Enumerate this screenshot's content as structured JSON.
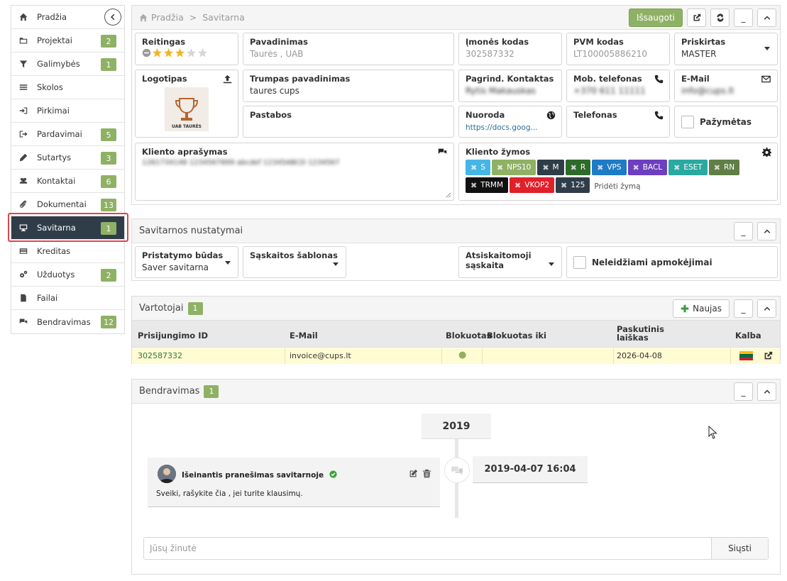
{
  "sidebar": {
    "items": [
      {
        "label": "Pradžia",
        "icon": "home-icon",
        "badge": ""
      },
      {
        "label": "Projektai",
        "icon": "folder-icon",
        "badge": "2"
      },
      {
        "label": "Galimybės",
        "icon": "filter-icon",
        "badge": "1"
      },
      {
        "label": "Skolos",
        "icon": "list-icon",
        "badge": ""
      },
      {
        "label": "Pirkimai",
        "icon": "sign-in-icon",
        "badge": ""
      },
      {
        "label": "Pardavimai",
        "icon": "sign-out-icon",
        "badge": "5"
      },
      {
        "label": "Sutartys",
        "icon": "pen-icon",
        "badge": "3"
      },
      {
        "label": "Kontaktai",
        "icon": "users-icon",
        "badge": "6"
      },
      {
        "label": "Dokumentai",
        "icon": "paperclip-icon",
        "badge": "13"
      },
      {
        "label": "Savitarna",
        "icon": "monitor-icon",
        "badge": "1"
      },
      {
        "label": "Kreditas",
        "icon": "credit-card-icon",
        "badge": ""
      },
      {
        "label": "Užduotys",
        "icon": "gears-icon",
        "badge": "2"
      },
      {
        "label": "Failai",
        "icon": "file-icon",
        "badge": ""
      },
      {
        "label": "Bendravimas",
        "icon": "comments-icon",
        "badge": "12"
      }
    ],
    "active_index": 9
  },
  "header": {
    "breadcrumb_home": "Pradžia",
    "breadcrumb_sep": ">",
    "breadcrumb_current": "Savitarna",
    "save_label": "Išsaugoti",
    "minimize_label": "_"
  },
  "client": {
    "rating_label": "Reitingas",
    "rating_value": 3,
    "rating_max": 5,
    "name_label": "Pavadinimas",
    "name_value": "Taurės , UAB",
    "company_code_label": "Įmonės kodas",
    "company_code_value": "302587332",
    "vat_label": "PVM kodas",
    "vat_value": "LT100005886210",
    "assigned_label": "Priskirtas",
    "assigned_value": "MASTER",
    "logo_label": "Logotipas",
    "logo_text": "UAB TAURĖS",
    "short_name_label": "Trumpas pavadinimas",
    "short_name_value": "taures cups",
    "main_contact_label": "Pagrind. Kontaktas",
    "main_contact_value": "Rytis Makauskas",
    "mobile_label": "Mob. telefonas",
    "mobile_value": "+370 611 11111",
    "email_label": "E-Mail",
    "email_value": "info@cups.lt",
    "notes_label": "Pastabos",
    "link_label": "Nuoroda",
    "link_value": "https://docs.goog...",
    "phone_label": "Telefonas",
    "marked_label": "Pažymėtas",
    "description_label": "Kliento aprašymas",
    "description_value": "1261734148 1234567899 abcdef 12345ABCD 1234567",
    "tags_label": "Kliento žymos",
    "tags": [
      {
        "label": "S",
        "color": "#45b6e6"
      },
      {
        "label": "NPS10",
        "color": "#8fb165"
      },
      {
        "label": "M",
        "color": "#2f3d49"
      },
      {
        "label": "R",
        "color": "#2e6b2b"
      },
      {
        "label": "VPS",
        "color": "#1e7bc6"
      },
      {
        "label": "BACL",
        "color": "#6d3fc0"
      },
      {
        "label": "ESET",
        "color": "#2aa9a0"
      },
      {
        "label": "RN",
        "color": "#5f7f46"
      },
      {
        "label": "TRMM",
        "color": "#111111"
      },
      {
        "label": "VKOP2",
        "color": "#e0202a"
      },
      {
        "label": "125",
        "color": "#2f3d49"
      }
    ],
    "add_tag_label": "Pridėti žymą"
  },
  "settings": {
    "title": "Savitarnos nustatymai",
    "presentation_label": "Pristatymo būdas",
    "presentation_value": "Saver savitarna",
    "invoice_template_label": "Sąskaitos šablonas",
    "invoice_template_value": "",
    "settlement_label": "Atsiskaitomoji sąskaita",
    "settlement_value": "",
    "disallowed_label": "Neleidžiami apmokėjimai"
  },
  "users": {
    "title": "Vartotojai",
    "count": "1",
    "new_label": "Naujas",
    "columns": [
      "Prisijungimo ID",
      "E-Mail",
      "Blokuotas",
      "Blokuotas iki",
      "Paskutinis laiškas",
      "Kalba"
    ],
    "rows": [
      {
        "login_id": "302587332",
        "email": "invoice@cups.lt",
        "blocked_dot": "●",
        "blocked_until": "",
        "last_letter": "2026-04-08",
        "language": "LT"
      }
    ]
  },
  "communication": {
    "title": "Bendravimas",
    "count": "1",
    "year": "2019",
    "message_title": "Išeinantis pranešimas savitarnoje",
    "message_body": "Sveiki, rašykite čia , jei turite klausimų.",
    "message_datetime": "2019-04-07 16:04",
    "compose_placeholder": "Jūsų žinutė",
    "send_label": "Siųsti"
  },
  "colors": {
    "accent_green": "#8fb165",
    "active_dark": "#2f3d49",
    "highlight_red": "#e0454b",
    "row_yellow": "#fffbd3"
  }
}
